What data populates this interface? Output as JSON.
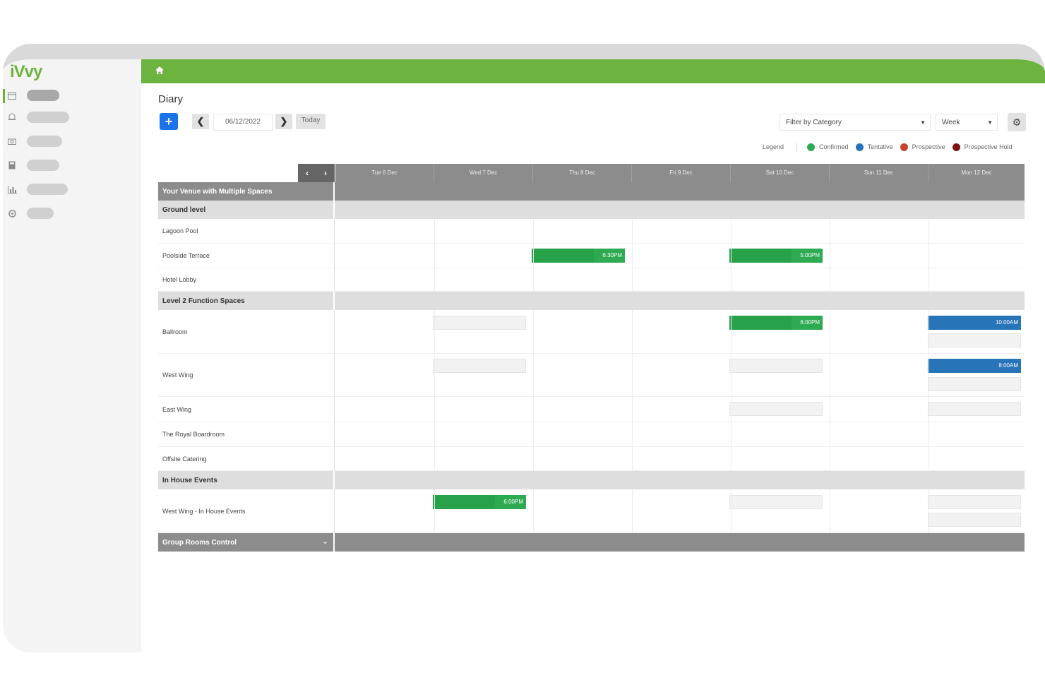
{
  "app": {
    "logo": "iVvy"
  },
  "sidebar": {
    "items": [
      {
        "icon": "calendar-icon",
        "active": true
      },
      {
        "icon": "bell-icon",
        "active": false
      },
      {
        "icon": "camera-icon",
        "active": false
      },
      {
        "icon": "calculator-icon",
        "active": false
      },
      {
        "icon": "chart-icon",
        "active": false
      },
      {
        "icon": "settings-icon",
        "active": false
      }
    ]
  },
  "topbar": {
    "icon": "home-icon"
  },
  "page": {
    "title": "Diary"
  },
  "toolbar": {
    "add_label": "+",
    "date_value": "06/12/2022",
    "today_label": "Today",
    "filter_label": "Filter by Category",
    "view_label": "Week"
  },
  "legend": {
    "title": "Legend",
    "items": [
      {
        "label": "Confirmed",
        "color": "#2eaa52"
      },
      {
        "label": "Tentative",
        "color": "#2774b8"
      },
      {
        "label": "Prospective",
        "color": "#c8442b"
      },
      {
        "label": "Prospective Hold",
        "color": "#7a1414"
      }
    ]
  },
  "calendar": {
    "days": [
      "Tue 6 Dec",
      "Wed 7 Dec",
      "Thu 8 Dec",
      "Fri 9 Dec",
      "Sat 10 Dec",
      "Sun 11 Dec",
      "Mon 12 Dec"
    ],
    "venue": "Your Venue with Multiple Spaces",
    "sections": [
      {
        "name": "Ground level",
        "spaces": [
          "Lagoon Pool",
          "Poolside Terrace",
          "Hotel Lobby"
        ]
      },
      {
        "name": "Level 2 Function Spaces",
        "spaces": [
          "Ballroom",
          "West Wing",
          "East Wing",
          "The Royal Boardroom",
          "Offsite Catering"
        ]
      },
      {
        "name": "In House Events",
        "spaces": [
          "West Wing - In House Events"
        ]
      }
    ],
    "bookings": [
      {
        "space": "Poolside Terrace",
        "day": 2,
        "time": "6:30PM",
        "status": "confirmed"
      },
      {
        "space": "Poolside Terrace",
        "day": 4,
        "time": "5:00PM",
        "status": "confirmed"
      },
      {
        "space": "Ballroom",
        "day": 4,
        "time": "6:00PM",
        "status": "confirmed"
      },
      {
        "space": "Ballroom",
        "day": 6,
        "time": "10:00AM",
        "status": "tentative"
      },
      {
        "space": "West Wing",
        "day": 6,
        "time": "8:00AM",
        "status": "tentative"
      },
      {
        "space": "West Wing - In House Events",
        "day": 1,
        "time": "6:00PM",
        "status": "confirmed"
      }
    ],
    "footer": "Group Rooms Control"
  }
}
